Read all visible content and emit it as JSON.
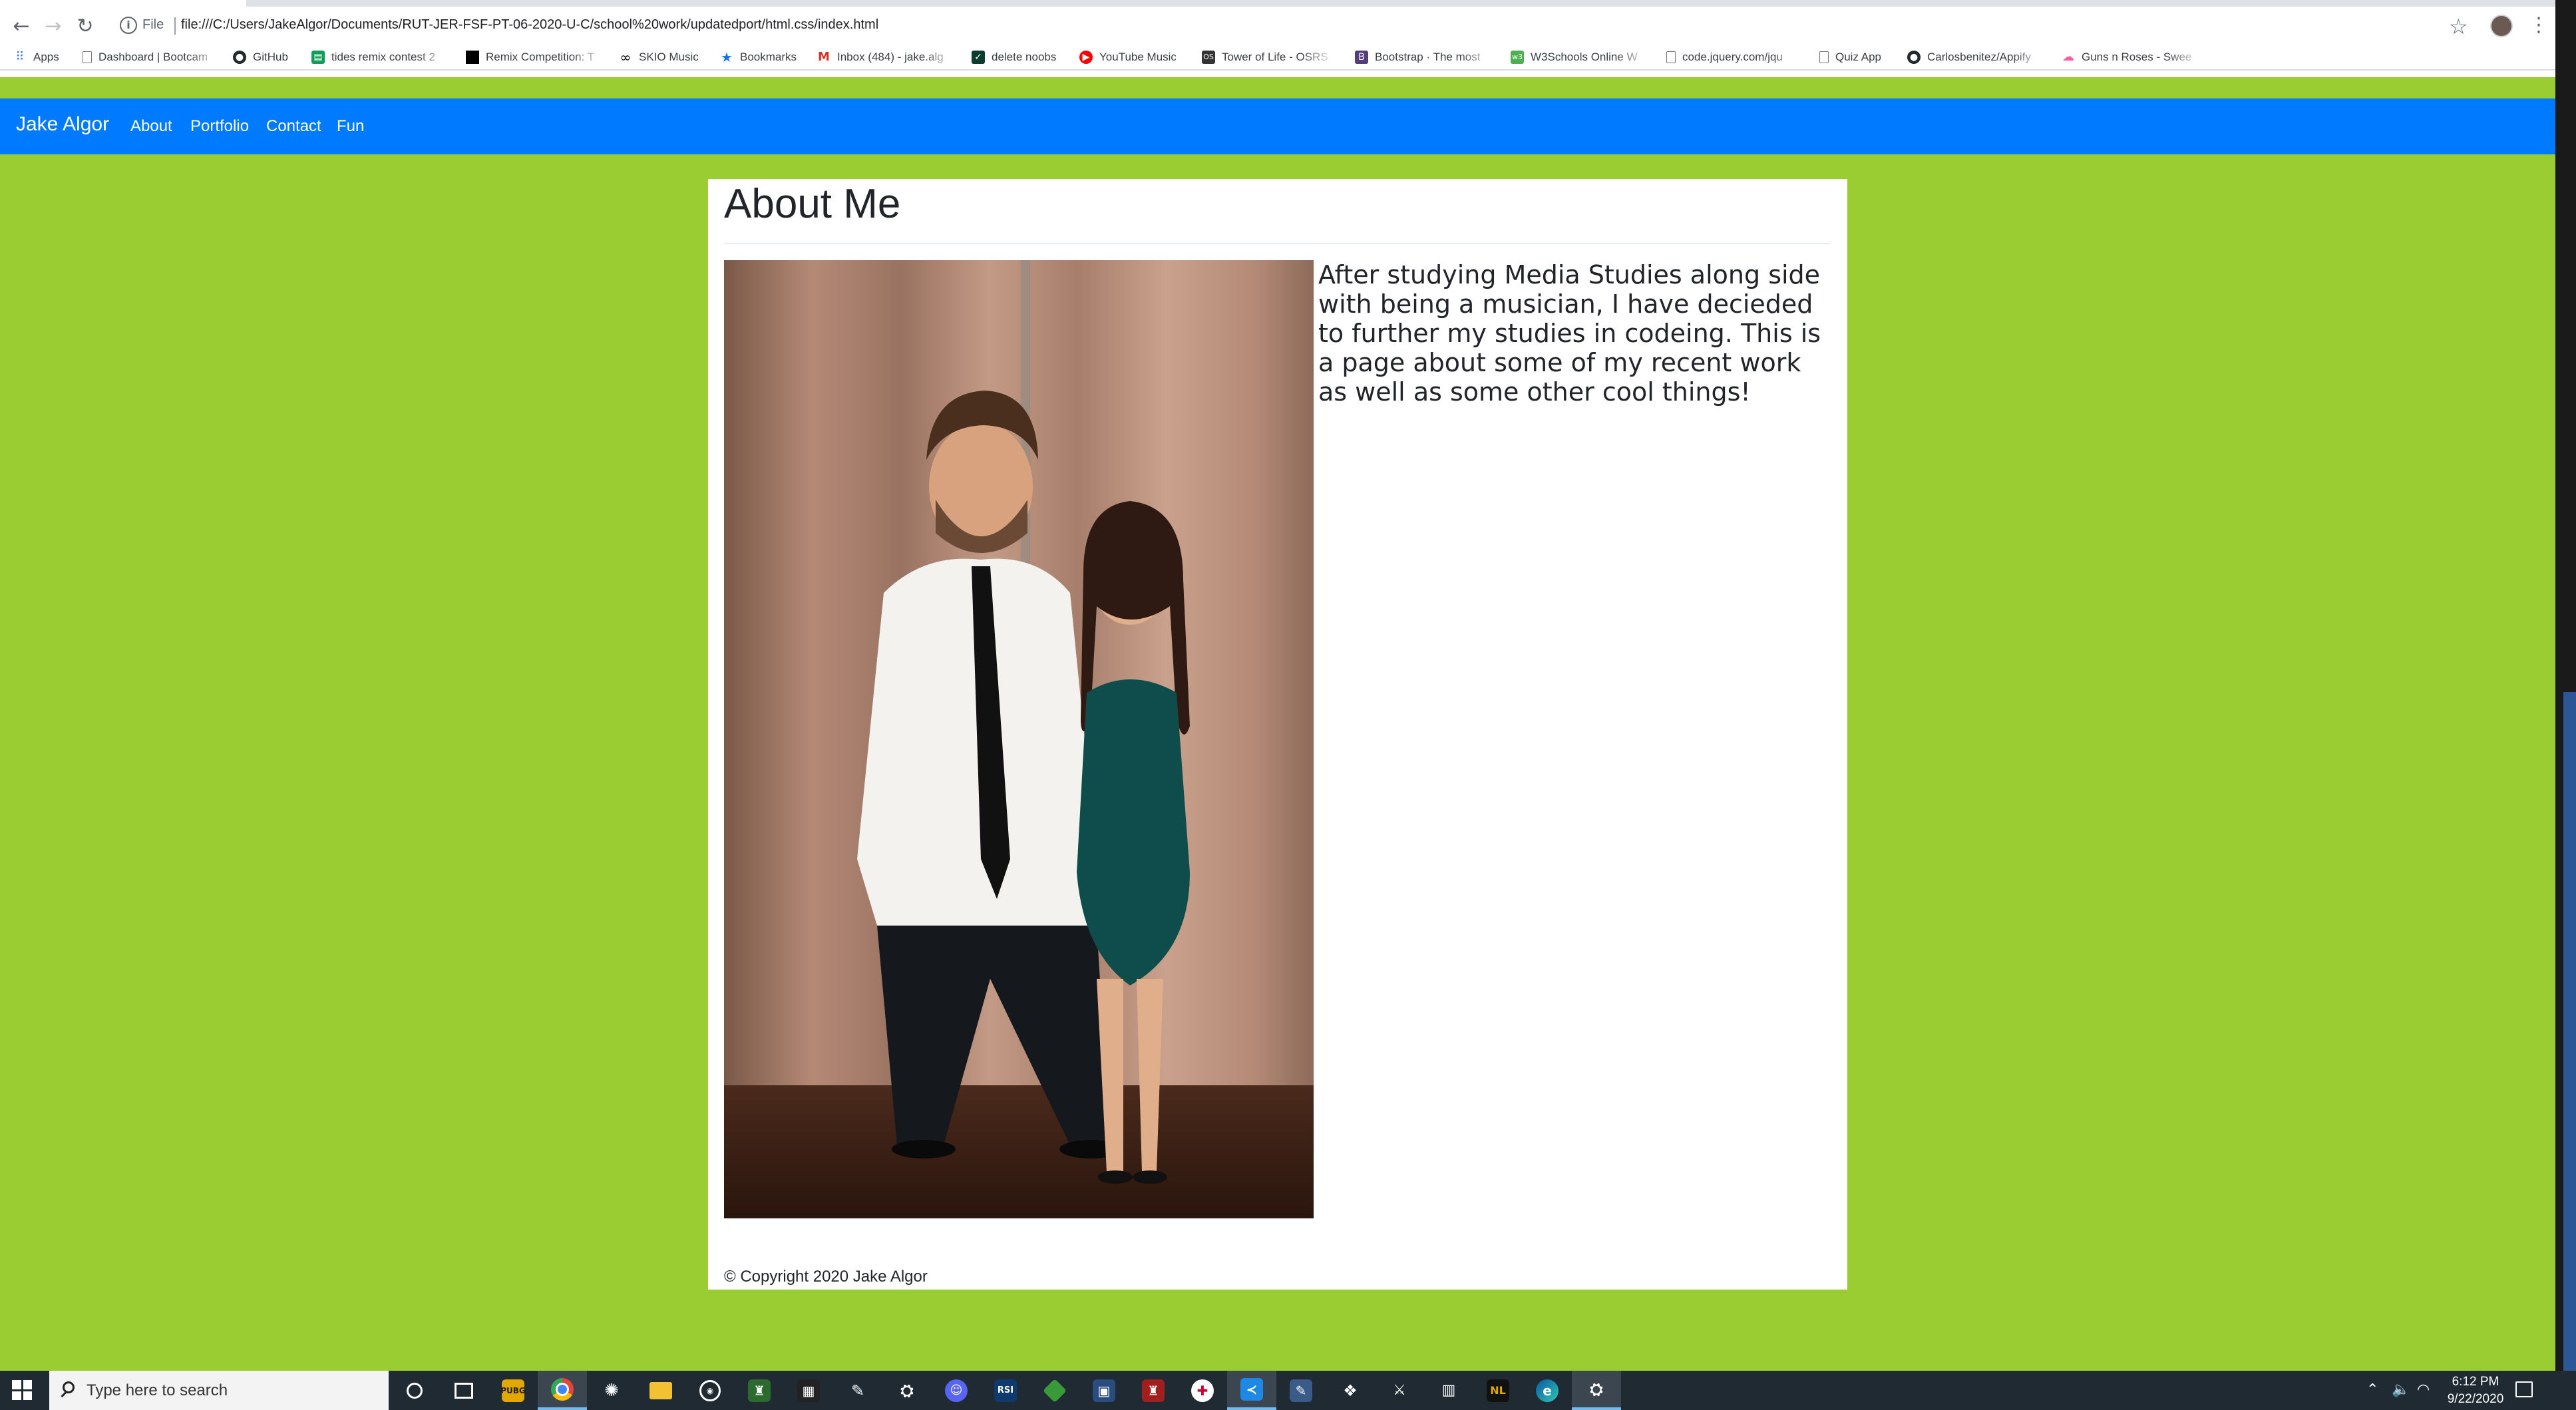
{
  "browser": {
    "scheme_label": "File",
    "url": "file:///C:/Users/JakeAlgor/Documents/RUT-JER-FSF-PT-06-2020-U-C/school%20work/updatedport/html.css/index.html",
    "bookmarks": [
      {
        "label": "Apps",
        "icon": "apps-grid-icon"
      },
      {
        "label": "Dashboard | Bootcam",
        "icon": "page-icon"
      },
      {
        "label": "GitHub",
        "icon": "github-icon"
      },
      {
        "label": "tides remix contest 2",
        "icon": "sheets-icon"
      },
      {
        "label": "Remix Competition: T",
        "icon": "remix-icon"
      },
      {
        "label": "SKIO Music",
        "icon": "infinity-icon"
      },
      {
        "label": "Bookmarks",
        "icon": "star-icon"
      },
      {
        "label": "Inbox (484) - jake.alg",
        "icon": "gmail-icon"
      },
      {
        "label": "delete noobs",
        "icon": "check-icon"
      },
      {
        "label": "YouTube Music",
        "icon": "youtube-music-icon"
      },
      {
        "label": "Tower of Life - OSRS",
        "icon": "osrs-icon"
      },
      {
        "label": "Bootstrap · The most",
        "icon": "bootstrap-icon"
      },
      {
        "label": "W3Schools Online W",
        "icon": "w3schools-icon"
      },
      {
        "label": "code.jquery.com/jqu",
        "icon": "page-icon"
      },
      {
        "label": "Quiz App",
        "icon": "page-icon"
      },
      {
        "label": "Carlosbenitez/Appify",
        "icon": "github-icon"
      },
      {
        "label": "Guns n Roses - Swee",
        "icon": "soundcloud-icon"
      }
    ]
  },
  "site": {
    "brand": "Jake Algor",
    "nav": [
      "About",
      "Portfolio",
      "Contact",
      "Fun"
    ],
    "page_title": "About Me",
    "about_text": "After studying Media Studies along side with being a musician, I have decieded to further my studies in codeing. This is a page about some of my recent work as well as some other cool things!",
    "footer": "© Copyright 2020 Jake Algor",
    "colors": {
      "page_bg": "#9acd32",
      "navbar": "#007bff",
      "card": "#ffffff"
    }
  },
  "taskbar": {
    "search_placeholder": "Type here to search",
    "time": "6:12 PM",
    "date": "9/22/2020"
  }
}
